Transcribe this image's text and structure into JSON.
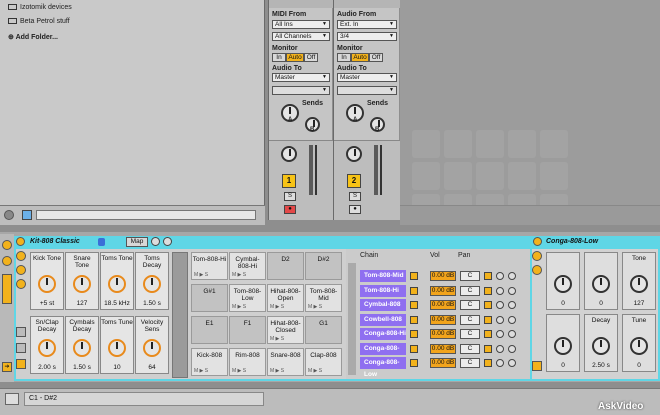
{
  "browser": {
    "items": [
      "Izotomik devices",
      "Beta Petrol stuff"
    ],
    "add_folder": "Add Folder..."
  },
  "mixer": {
    "midi_track": {
      "midi_from_label": "MIDI From",
      "midi_from": "All Ins",
      "channel": "All Channels",
      "monitor_label": "Monitor",
      "monitor_options": [
        "In",
        "Auto",
        "Off"
      ],
      "monitor_selected": "Auto",
      "audio_to_label": "Audio To",
      "audio_to": "Master",
      "sends_label": "Sends",
      "send_a": "A",
      "send_b": "B",
      "track_number": "1"
    },
    "audio_track": {
      "audio_from_label": "Audio From",
      "audio_from": "Ext. In",
      "channel": "3/4",
      "monitor_label": "Monitor",
      "monitor_options": [
        "In",
        "Auto",
        "Off"
      ],
      "monitor_selected": "Auto",
      "audio_to_label": "Audio To",
      "audio_to": "Master",
      "sends_label": "Sends",
      "send_a": "A",
      "send_b": "B",
      "track_number": "2"
    }
  },
  "rack": {
    "title": "Kit-808 Classic",
    "map_label": "Map",
    "macros": [
      {
        "name": "Kick Tone",
        "value": "+5 st"
      },
      {
        "name": "Snare Tone",
        "value": "127"
      },
      {
        "name": "Toms Tone",
        "value": "18.5 kHz"
      },
      {
        "name": "Toms Decay",
        "value": "1.50 s"
      },
      {
        "name": "Sn/Clap Decay",
        "value": "2.00 s"
      },
      {
        "name": "Cymbals Decay",
        "value": "1.50 s"
      },
      {
        "name": "Toms Tune",
        "value": "10"
      },
      {
        "name": "Velocity Sens",
        "value": "64"
      }
    ],
    "pads": [
      [
        "Tom-808-Hi",
        "Cymbal-808-Hi",
        "D2",
        "D#2"
      ],
      [
        "G#1",
        "Tom-808-Low",
        "Hihat-808-Open",
        "Tom-808-Mid"
      ],
      [
        "E1",
        "F1",
        "Hihat-808-Closed",
        "G1"
      ],
      [
        "Kick-808",
        "Rim-808",
        "Snare-808",
        "Clap-808"
      ]
    ],
    "pad_mps": "M ▶ S",
    "chain_header": "Chain",
    "vol_header": "Vol",
    "pan_header": "Pan",
    "chains": [
      {
        "name": "Tom-808-Mid",
        "vol": "0.00 dB",
        "pan": "C"
      },
      {
        "name": "Tom-808-Hi",
        "vol": "0.00 dB",
        "pan": "C"
      },
      {
        "name": "Cymbal-808",
        "vol": "0.00 dB",
        "pan": "C"
      },
      {
        "name": "Cowbell-808",
        "vol": "0.00 dB",
        "pan": "C"
      },
      {
        "name": "Conga-808-Hi",
        "vol": "0.00 dB",
        "pan": "C"
      },
      {
        "name": "Conga-808-Mid",
        "vol": "0.00 dB",
        "pan": "C"
      },
      {
        "name": "Conga-808-Low",
        "vol": "0.00 dB",
        "pan": "C"
      }
    ]
  },
  "conga": {
    "title": "Conga-808-Low",
    "knobs": [
      {
        "name": "",
        "value": "0"
      },
      {
        "name": "",
        "value": "0"
      },
      {
        "name": "Tone",
        "value": "127"
      },
      {
        "name": "",
        "value": "0"
      },
      {
        "name": "Decay",
        "value": "2.50 s"
      },
      {
        "name": "Tune",
        "value": "0"
      }
    ]
  },
  "status": {
    "range": "C1 - D#2"
  },
  "watermark": "AskVideo",
  "colors": {
    "accent": "#5fd6e6",
    "chain": "#8f6ff0",
    "orange": "#f2a41c"
  }
}
